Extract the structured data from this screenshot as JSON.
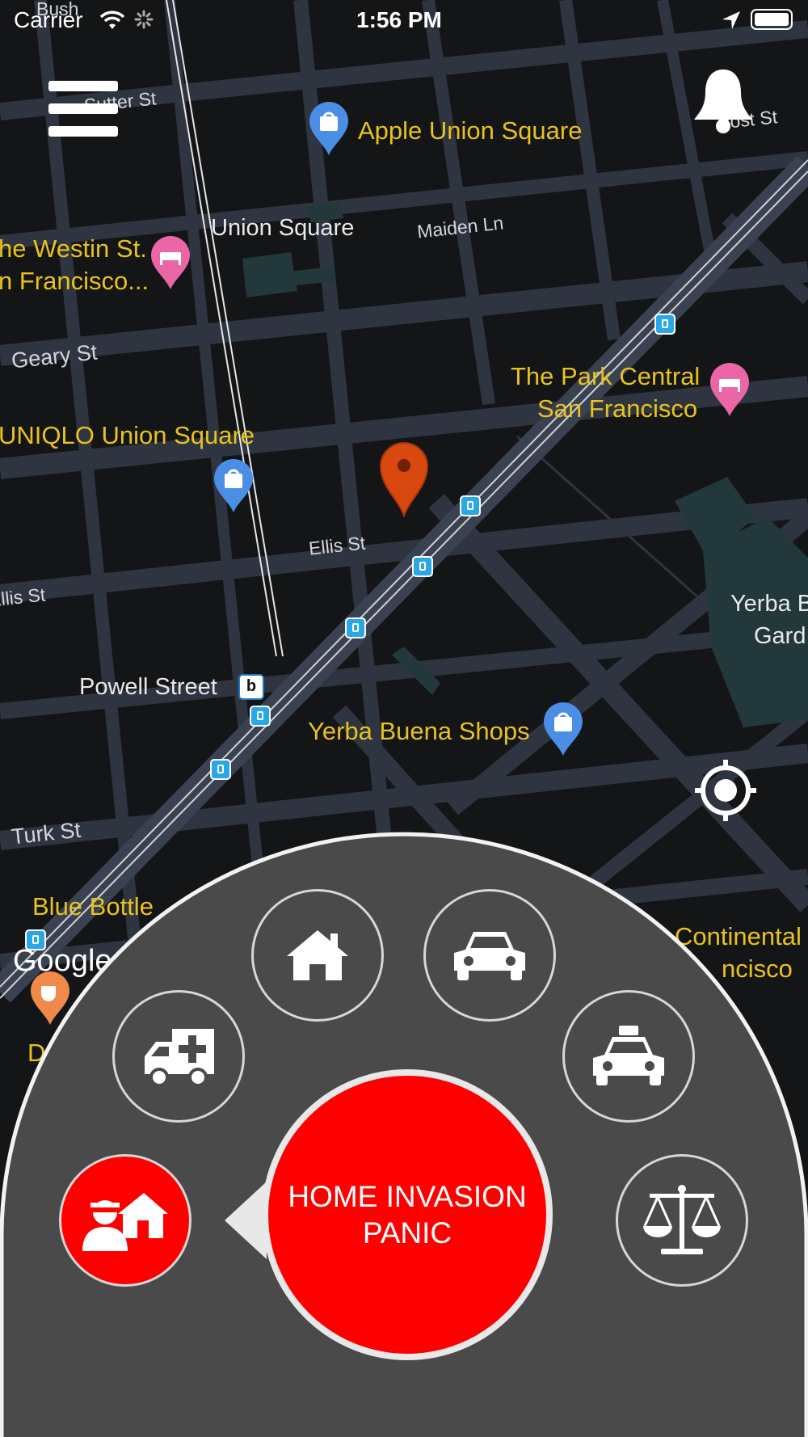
{
  "status_bar": {
    "carrier": "Carrier",
    "time": "1:56 PM"
  },
  "map": {
    "attribution": "Google",
    "places": {
      "apple_union_square": "Apple Union Square",
      "union_square": "Union Square",
      "westin_line1": "he Westin St.",
      "westin_line2": "n Francisco...",
      "park_central_line1": "The Park Central",
      "park_central_line2": "San Francisco",
      "uniqlo": "UNIQLO Union Square",
      "powell_street": "Powell Street",
      "yerba_buena_shops": "Yerba Buena Shops",
      "yerba_buena_gardens_line1": "Yerba B",
      "yerba_buena_gardens_line2": "Gard",
      "blue_bottle": "Blue Bottle",
      "continental_line1": "Continental",
      "continental_line2": "ncisco",
      "d_fragment": "D"
    },
    "streets": {
      "sutter": "Sutter St",
      "post": "Post St",
      "maiden_ln": "Maiden Ln",
      "geary": "Geary St",
      "ellis_center": "Ellis St",
      "ellis_left": "Ellis St",
      "turk": "Turk St",
      "bush": "Bush"
    }
  },
  "header": {
    "menu_icon": "hamburger-menu-icon",
    "bell_icon": "bell-icon"
  },
  "locate_icon": "my-location-crosshair-icon",
  "emergency_menu": {
    "panic_label": "HOME INVASION\nPANIC",
    "selected": "home-invasion",
    "options": [
      {
        "id": "home",
        "icon": "house-icon"
      },
      {
        "id": "car",
        "icon": "car-icon"
      },
      {
        "id": "medical",
        "icon": "ambulance-icon"
      },
      {
        "id": "taxi",
        "icon": "taxi-icon"
      },
      {
        "id": "home-invasion",
        "icon": "burglar-house-icon"
      },
      {
        "id": "legal",
        "icon": "scales-of-justice-icon"
      }
    ]
  },
  "colors": {
    "panic_red": "#ff0000",
    "panel_gray": "#4a4a4a",
    "poi_yellow": "#e8c21e",
    "pin_orange": "#d9480f",
    "transit_blue": "#2aa7e6",
    "hotel_pink": "#ea66a6",
    "shop_blue": "#4a8ee6"
  }
}
